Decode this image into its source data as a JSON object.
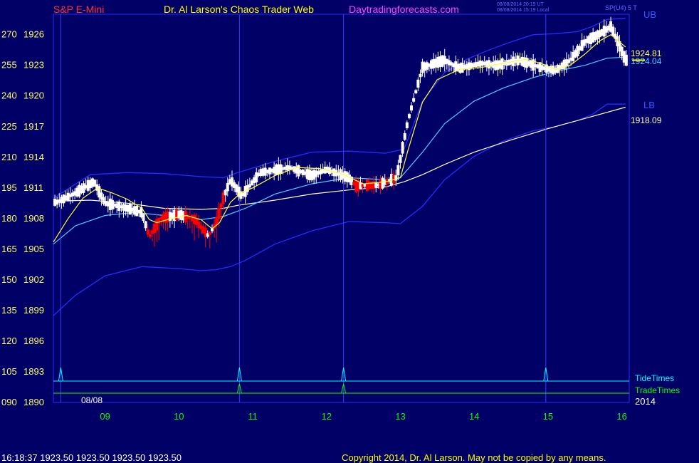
{
  "header": {
    "instrument": "S&P E-Mini",
    "site_title": "Dr. Al Larson's Chaos Trader Web",
    "site_url": "Daytradingforecasts.com",
    "timestamp_ut": "08/08/2014 20:19 UT",
    "timestamp_local": "08/08/2014 15:19 Local",
    "symbol_code": "SP(U4) 5 T"
  },
  "footer": {
    "last_quote": "16:18:37  1923.50 1923.50 1923.50 1923.50",
    "copyright": "Copyright 2014, Dr. Al Larson. May not be copied by any means."
  },
  "colors": {
    "background": "#000066",
    "bands": "#2a2aff",
    "sma_slow": "#ffffcc",
    "sma_mid": "#4fd0ff",
    "sma_fast": "#ffff33",
    "up_candle": "#ffffff",
    "down_candle": "#ff0000",
    "tide": "#00ffff",
    "trade": "#00ff00",
    "x_tick": "#00ff00",
    "y_label": "#ffff66"
  },
  "chart_data": {
    "type": "candlestick",
    "date_label": "08/08",
    "year_label": "2014",
    "x_range": [
      8.3,
      16.1
    ],
    "x_ticks": [
      "09",
      "10",
      "11",
      "12",
      "13",
      "14",
      "15",
      "16"
    ],
    "y_range": [
      1890,
      1928
    ],
    "y_ticks": [
      {
        "osc": "270",
        "price": "1926"
      },
      {
        "osc": "255",
        "price": "1923"
      },
      {
        "osc": "240",
        "price": "1920"
      },
      {
        "osc": "225",
        "price": "1917"
      },
      {
        "osc": "210",
        "price": "1914"
      },
      {
        "osc": "195",
        "price": "1911"
      },
      {
        "osc": "180",
        "price": "1908"
      },
      {
        "osc": "165",
        "price": "1905"
      },
      {
        "osc": "150",
        "price": "1902"
      },
      {
        "osc": "135",
        "price": "1899"
      },
      {
        "osc": "120",
        "price": "1896"
      },
      {
        "osc": "105",
        "price": "1893"
      },
      {
        "osc": "090",
        "price": "1890"
      }
    ],
    "band_labels": {
      "upper": "UB",
      "lower": "LB"
    },
    "value_labels": {
      "fast": "1924.81",
      "mid": "1924.04",
      "slow": "1918.09"
    },
    "last_price": 1923.5,
    "time_markers": {
      "tide_label": "TideTimes",
      "trade_label": "TradeTimes",
      "tide_times": [
        8.4,
        10.82,
        12.23,
        14.97
      ],
      "trade_times": [
        10.82,
        12.23
      ]
    },
    "candle_anchors": [
      [
        8.35,
        1909.6
      ],
      [
        8.6,
        1910.5
      ],
      [
        8.85,
        1911.6
      ],
      [
        9.0,
        1909.5
      ],
      [
        9.2,
        1909.2
      ],
      [
        9.5,
        1908.6
      ],
      [
        9.6,
        1906.2
      ],
      [
        9.75,
        1908.0
      ],
      [
        10.0,
        1908.4
      ],
      [
        10.2,
        1908.0
      ],
      [
        10.4,
        1906.3
      ],
      [
        10.5,
        1907.5
      ],
      [
        10.6,
        1910.0
      ],
      [
        10.7,
        1911.8
      ],
      [
        10.85,
        1910.2
      ],
      [
        11.1,
        1912.5
      ],
      [
        11.5,
        1913.0
      ],
      [
        11.8,
        1912.2
      ],
      [
        12.0,
        1912.8
      ],
      [
        12.3,
        1912.0
      ],
      [
        12.4,
        1911.2
      ],
      [
        12.7,
        1911.3
      ],
      [
        12.95,
        1912.0
      ],
      [
        13.1,
        1917.5
      ],
      [
        13.3,
        1922.8
      ],
      [
        13.6,
        1923.5
      ],
      [
        13.8,
        1922.7
      ],
      [
        14.1,
        1923.2
      ],
      [
        14.3,
        1923.0
      ],
      [
        14.6,
        1923.5
      ],
      [
        14.9,
        1922.8
      ],
      [
        15.1,
        1922.5
      ],
      [
        15.3,
        1923.5
      ],
      [
        15.5,
        1925.3
      ],
      [
        15.75,
        1926.3
      ],
      [
        15.85,
        1926.8
      ],
      [
        15.95,
        1925.2
      ],
      [
        16.05,
        1923.5
      ]
    ],
    "series": [
      {
        "key": "upper_band",
        "x": [
          8.3,
          8.8,
          9.3,
          9.8,
          10.3,
          10.6,
          10.8,
          11.3,
          11.8,
          12.3,
          12.8,
          13.05,
          13.3,
          13.6,
          13.9,
          14.2,
          14.5,
          14.8,
          15.1,
          15.4,
          15.6,
          15.8,
          16.05
        ],
        "y": [
          1910.0,
          1912.3,
          1912.5,
          1912.4,
          1912.1,
          1912.0,
          1912.5,
          1913.6,
          1914.5,
          1914.6,
          1914.4,
          1914.8,
          1919.5,
          1922.3,
          1923.6,
          1924.5,
          1925.3,
          1926.0,
          1926.1,
          1926.3,
          1926.8,
          1927.5,
          1927.6
        ]
      },
      {
        "key": "lower_band",
        "x": [
          8.3,
          8.6,
          9.0,
          9.5,
          10.0,
          10.3,
          10.5,
          10.7,
          10.9,
          11.3,
          11.8,
          12.3,
          12.8,
          13.0,
          13.3,
          13.6,
          14.0,
          14.4,
          14.8,
          15.1,
          15.4,
          15.6,
          15.8,
          16.05
        ],
        "y": [
          1898.5,
          1900.5,
          1902.4,
          1903.3,
          1903.1,
          1902.9,
          1903.0,
          1903.3,
          1903.9,
          1905.5,
          1906.8,
          1907.7,
          1907.6,
          1907.5,
          1909.2,
          1911.8,
          1914.1,
          1915.6,
          1916.6,
          1917.0,
          1917.6,
          1918.2,
          1919.2,
          1919.2
        ]
      },
      {
        "key": "sma_slow",
        "x": [
          8.3,
          8.8,
          9.3,
          9.8,
          10.3,
          10.6,
          10.8,
          11.3,
          11.8,
          12.3,
          12.8,
          13.05,
          13.3,
          13.6,
          14.0,
          14.5,
          15.0,
          15.5,
          16.05
        ],
        "y": [
          1909.7,
          1909.8,
          1909.5,
          1909.0,
          1908.9,
          1909.0,
          1909.3,
          1909.8,
          1910.4,
          1910.8,
          1911.1,
          1911.6,
          1912.3,
          1913.3,
          1914.5,
          1915.7,
          1916.8,
          1917.8,
          1918.9
        ]
      },
      {
        "key": "sma_mid",
        "x": [
          8.3,
          8.6,
          9.0,
          9.4,
          9.8,
          10.3,
          10.6,
          10.9,
          11.3,
          11.8,
          12.3,
          12.8,
          13.0,
          13.3,
          13.6,
          14.0,
          14.4,
          14.8,
          15.1,
          15.5,
          15.8,
          16.05
        ],
        "y": [
          1905.5,
          1907.3,
          1908.3,
          1908.6,
          1908.3,
          1907.9,
          1908.2,
          1909.0,
          1910.4,
          1911.4,
          1912.0,
          1911.8,
          1912.0,
          1914.5,
          1917.3,
          1919.5,
          1920.8,
          1921.8,
          1922.4,
          1923.0,
          1923.7,
          1923.8
        ]
      },
      {
        "key": "sma_fast",
        "x": [
          8.3,
          8.5,
          8.7,
          8.9,
          9.1,
          9.3,
          9.5,
          9.6,
          9.7,
          9.9,
          10.1,
          10.3,
          10.45,
          10.55,
          10.7,
          10.85,
          11.0,
          11.3,
          11.6,
          11.9,
          12.2,
          12.5,
          12.8,
          13.0,
          13.1,
          13.3,
          13.5,
          13.8,
          14.1,
          14.4,
          14.7,
          14.9,
          15.1,
          15.3,
          15.5,
          15.7,
          15.85,
          16.05
        ],
        "y": [
          1905.7,
          1908.0,
          1910.0,
          1911.0,
          1910.5,
          1909.9,
          1909.0,
          1907.9,
          1907.6,
          1908.0,
          1908.3,
          1907.9,
          1907.0,
          1907.6,
          1909.6,
          1910.6,
          1911.0,
          1912.2,
          1913.0,
          1912.9,
          1912.4,
          1911.4,
          1911.6,
          1912.0,
          1914.6,
          1919.4,
          1921.6,
          1922.6,
          1922.8,
          1923.2,
          1923.6,
          1923.2,
          1922.6,
          1923.0,
          1924.1,
          1925.4,
          1926.0,
          1924.8
        ]
      }
    ]
  }
}
